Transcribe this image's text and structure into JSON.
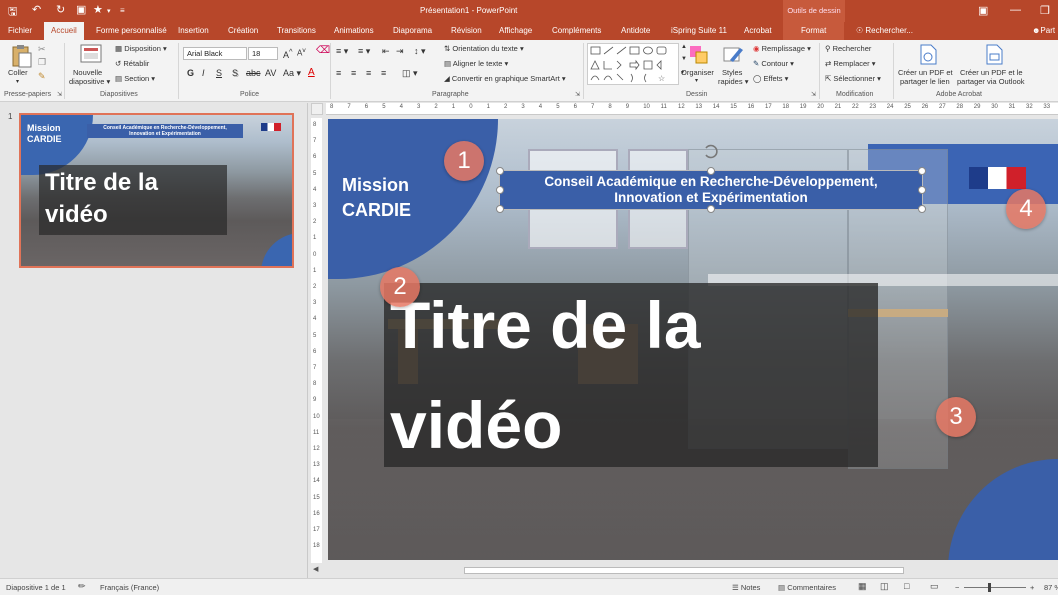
{
  "window": {
    "title": "Présentation1 - PowerPoint",
    "context_tab_header": "Outils de dessin",
    "colors": {
      "accent": "#b7472a",
      "slide_blue": "#3a5fa8",
      "marker": "#e07864"
    }
  },
  "quick_access": {
    "icons": [
      "save-icon",
      "undo-icon",
      "redo-icon",
      "present-icon",
      "star-icon",
      "customize-icon"
    ]
  },
  "tabs": [
    {
      "label": "Fichier"
    },
    {
      "label": "Accueil",
      "active": true
    },
    {
      "label": "Forme personnalisé"
    },
    {
      "label": "Insertion"
    },
    {
      "label": "Création"
    },
    {
      "label": "Transitions"
    },
    {
      "label": "Animations"
    },
    {
      "label": "Diaporama"
    },
    {
      "label": "Révision"
    },
    {
      "label": "Affichage"
    },
    {
      "label": "Compléments"
    },
    {
      "label": "Antidote"
    },
    {
      "label": "iSpring Suite 11"
    },
    {
      "label": "Acrobat"
    },
    {
      "label": "Format"
    }
  ],
  "search": {
    "label": "Rechercher..."
  },
  "user_partial": "Part",
  "ribbon": {
    "clipboard": {
      "paste": "Coller",
      "label": "Presse-papiers"
    },
    "slides": {
      "new_slide_1": "Nouvelle",
      "new_slide_2": "diapositive",
      "layout": "Disposition",
      "reset": "Rétablir",
      "section": "Section",
      "label": "Diapositives"
    },
    "font": {
      "name": "Arial Black",
      "size": "18",
      "label": "Police"
    },
    "paragraph": {
      "text_direction": "Orientation du texte",
      "align_text": "Aligner le texte",
      "smartart": "Convertir en graphique SmartArt",
      "label": "Paragraphe"
    },
    "drawing": {
      "arrange": "Organiser",
      "styles_1": "Styles",
      "styles_2": "rapides",
      "fill": "Remplissage",
      "outline": "Contour",
      "effects": "Effets",
      "label": "Dessin"
    },
    "editing": {
      "find": "Rechercher",
      "replace": "Remplacer",
      "select": "Sélectionner",
      "label": "Modification"
    },
    "acrobat": {
      "pdf_link_1": "Créer un PDF et",
      "pdf_link_2": "partager le lien",
      "pdf_outlook_1": "Créer un PDF et le",
      "pdf_outlook_2": "partager via Outlook",
      "label": "Adobe Acrobat"
    }
  },
  "thumbnail": {
    "number": "1",
    "mission": "Mission",
    "cardie": "CARDIE",
    "banner_1": "Conseil Académique en Recherche-Développement,",
    "banner_2": "Innovation et Expérimentation",
    "title_1": "Titre de la",
    "title_2": "vidéo"
  },
  "ruler": {
    "h_ticks": [
      "8",
      "7",
      "6",
      "5",
      "4",
      "3",
      "2",
      "1",
      "0",
      "1",
      "2",
      "3",
      "4",
      "5",
      "6",
      "7",
      "8",
      "9",
      "10",
      "11",
      "12",
      "13",
      "14",
      "15",
      "16",
      "17",
      "18",
      "19",
      "20",
      "21",
      "22",
      "23",
      "24",
      "25",
      "26",
      "27",
      "28",
      "29",
      "30",
      "31",
      "32",
      "33"
    ],
    "v_ticks": [
      "8",
      "7",
      "6",
      "5",
      "4",
      "3",
      "2",
      "1",
      "0",
      "1",
      "2",
      "3",
      "4",
      "5",
      "6",
      "7",
      "8",
      "9",
      "10",
      "11",
      "12",
      "13",
      "14",
      "15",
      "16",
      "17",
      "18"
    ]
  },
  "slide": {
    "mission": "Mission",
    "cardie": "CARDIE",
    "banner_line1": "Conseil Académique en Recherche-Développement,",
    "banner_line2": "Innovation et Expérimentation",
    "title_line1": "Titre de la",
    "title_line2": "vidéo",
    "markers": [
      "1",
      "2",
      "3",
      "4"
    ]
  },
  "status": {
    "slide_info": "Diapositive 1 de 1",
    "language": "Français (France)",
    "notes": "Notes",
    "comments": "Commentaires",
    "zoom": "87 %"
  }
}
